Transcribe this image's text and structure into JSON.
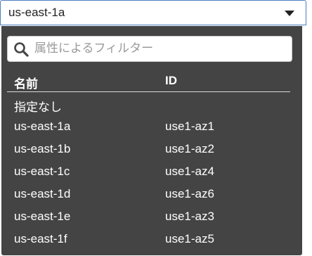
{
  "select": {
    "value": "us-east-1a"
  },
  "search": {
    "placeholder": "属性によるフィルター"
  },
  "columns": {
    "name": "名前",
    "id": "ID"
  },
  "options": [
    {
      "name": "指定なし",
      "id": ""
    },
    {
      "name": "us-east-1a",
      "id": "use1-az1"
    },
    {
      "name": "us-east-1b",
      "id": "use1-az2"
    },
    {
      "name": "us-east-1c",
      "id": "use1-az4"
    },
    {
      "name": "us-east-1d",
      "id": "use1-az6"
    },
    {
      "name": "us-east-1e",
      "id": "use1-az3"
    },
    {
      "name": "us-east-1f",
      "id": "use1-az5"
    }
  ],
  "colors": {
    "panel": "#444444",
    "border": "#4d7ec2"
  },
  "icons": {
    "search": "search-icon",
    "caret": "chevron-down-icon"
  }
}
